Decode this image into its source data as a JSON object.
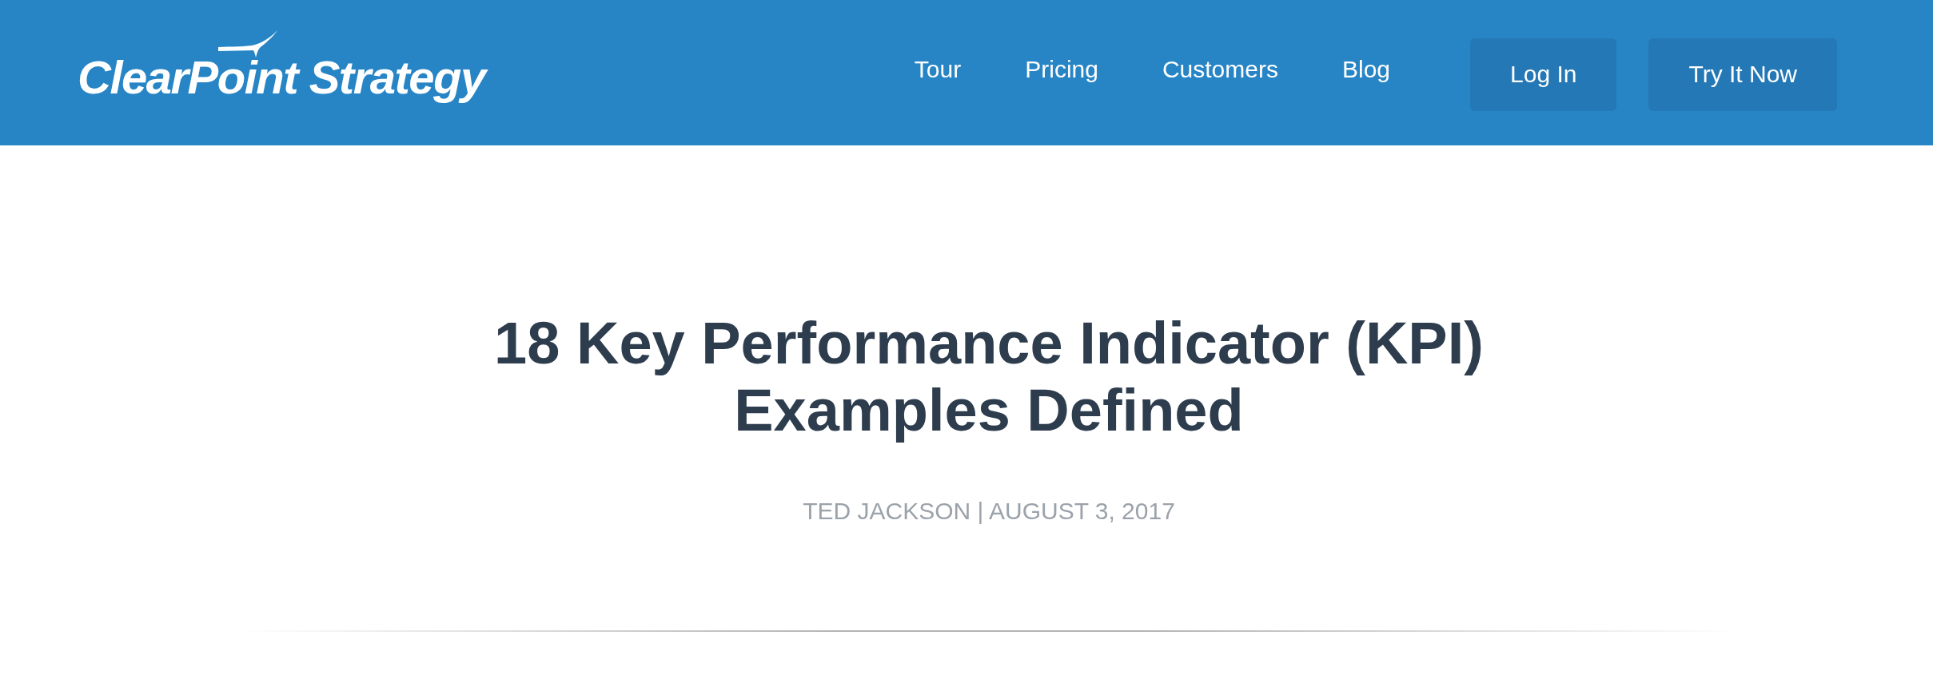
{
  "header": {
    "logo": {
      "text": "ClearPoint Strategy"
    },
    "nav_links": [
      {
        "label": "Tour"
      },
      {
        "label": "Pricing"
      },
      {
        "label": "Customers"
      },
      {
        "label": "Blog"
      }
    ],
    "buttons": [
      {
        "label": "Log In"
      },
      {
        "label": "Try It Now"
      }
    ]
  },
  "article": {
    "title": "18 Key Performance Indicator (KPI) Examples Defined",
    "byline": "TED JACKSON | AUGUST 3, 2017"
  }
}
